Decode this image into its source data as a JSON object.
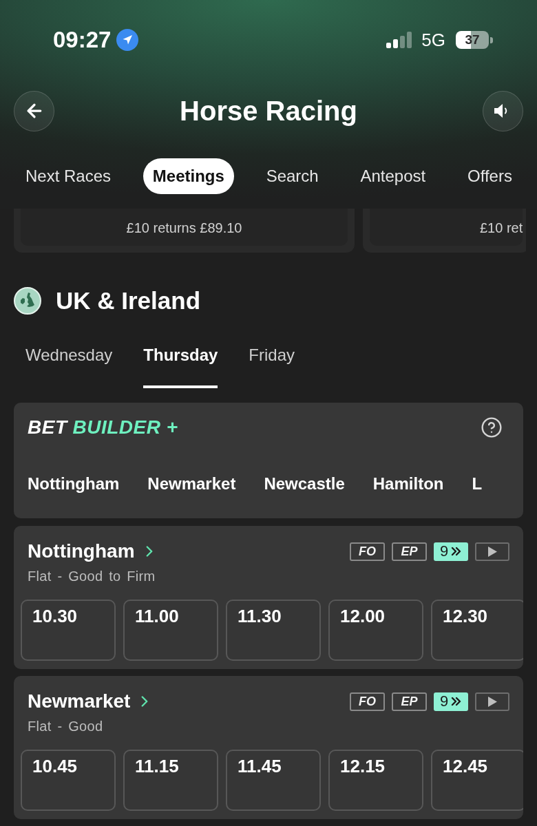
{
  "status_bar": {
    "time": "09:27",
    "network": "5G",
    "battery": "37"
  },
  "header": {
    "title": "Horse Racing"
  },
  "tabs": [
    {
      "label": "Next Races",
      "selected": false
    },
    {
      "label": "Meetings",
      "selected": true
    },
    {
      "label": "Search",
      "selected": false
    },
    {
      "label": "Antepost",
      "selected": false
    },
    {
      "label": "Offers",
      "selected": false
    }
  ],
  "offers": [
    {
      "returns": "£10 returns £89.10"
    },
    {
      "returns": "£10 ret"
    }
  ],
  "region": {
    "title": "UK & Ireland"
  },
  "days": [
    {
      "label": "Wednesday",
      "selected": false
    },
    {
      "label": "Thursday",
      "selected": true
    },
    {
      "label": "Friday",
      "selected": false
    }
  ],
  "bet_builder": {
    "title_start": "BET",
    "title_end": "BUILDER +",
    "venues": [
      "Nottingham",
      "Newmarket",
      "Newcastle",
      "Hamilton",
      "L"
    ]
  },
  "meetings": [
    {
      "name": "Nottingham",
      "going": "Flat - Good to Firm",
      "badges": [
        {
          "kind": "outline",
          "label": "FO"
        },
        {
          "kind": "outline",
          "label": "EP"
        },
        {
          "kind": "count",
          "label": "9"
        },
        {
          "kind": "play"
        }
      ],
      "times": [
        "10.30",
        "11.00",
        "11.30",
        "12.00",
        "12.30"
      ]
    },
    {
      "name": "Newmarket",
      "going": "Flat - Good",
      "badges": [
        {
          "kind": "outline",
          "label": "FO"
        },
        {
          "kind": "outline",
          "label": "EP"
        },
        {
          "kind": "count",
          "label": "9"
        },
        {
          "kind": "play"
        }
      ],
      "times": [
        "10.45",
        "11.15",
        "11.45",
        "12.15",
        "12.45"
      ]
    }
  ]
}
